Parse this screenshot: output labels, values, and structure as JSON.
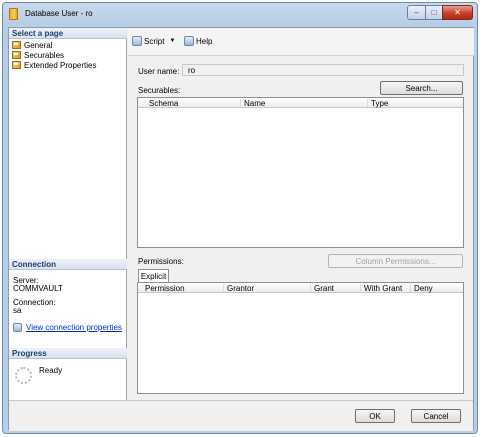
{
  "window": {
    "title": "Database User - ro",
    "controls": {
      "minimize": "–",
      "maximize": "□",
      "close": "✕"
    }
  },
  "left_pane": {
    "select_page_header": "Select a page",
    "pages": [
      "General",
      "Securables",
      "Extended Properties"
    ],
    "connection": {
      "header": "Connection",
      "server_label": "Server:",
      "server_value": "COMMVAULT",
      "connection_label": "Connection:",
      "connection_value": "sa",
      "view_properties_link": "View connection properties"
    },
    "progress": {
      "header": "Progress",
      "status": "Ready"
    }
  },
  "toolbar": {
    "script_label": "Script",
    "help_label": "Help"
  },
  "user_name": {
    "label": "User name:",
    "value": "ro"
  },
  "securables": {
    "label": "Securables:",
    "search_button": "Search...",
    "columns": [
      "Schema",
      "Name",
      "Type"
    ]
  },
  "permissions": {
    "label": "Permissions:",
    "column_permissions_button": "Column Permissions...",
    "tab": "Explicit",
    "columns": [
      "Permission",
      "Grantor",
      "Grant",
      "With Grant",
      "Deny"
    ]
  },
  "footer": {
    "ok": "OK",
    "cancel": "Cancel"
  },
  "colors": {
    "title_bar": "#b8cde6",
    "close_button": "#c8402a",
    "link": "#0033cc",
    "section_header_text": "#1f3d6e"
  },
  "icons": {
    "app": "database-user-icon",
    "page": "page-icon",
    "script": "script-icon",
    "help": "help-icon",
    "connection": "connection-icon",
    "progress": "spinner-icon"
  }
}
